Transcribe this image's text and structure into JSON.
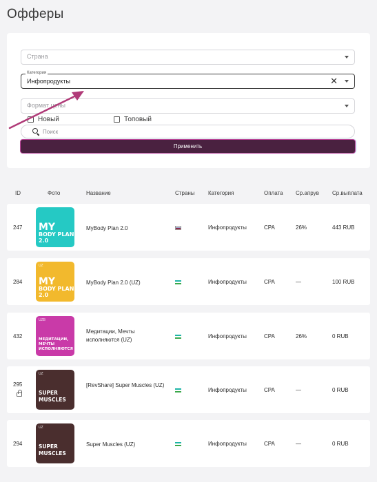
{
  "page": {
    "title": "Офферы"
  },
  "filters": {
    "country": {
      "placeholder": "Страна"
    },
    "category": {
      "label": "Категория",
      "value": "Инфопродукты",
      "clear": "✕"
    },
    "format": {
      "placeholder": "Формат цены"
    },
    "new_label": "Новый",
    "top_label": "Топовый",
    "search": {
      "placeholder": "Поиск"
    },
    "apply_label": "Применить"
  },
  "table": {
    "headers": {
      "id": "ID",
      "photo": "Фото",
      "name": "Название",
      "countries": "Страны",
      "category": "Категория",
      "payment": "Оплата",
      "approval": "Ср.апрув",
      "payout": "Ср.выплата"
    },
    "rows": [
      {
        "id": "247",
        "name": "MyBody Plan 2.0",
        "flag": "ru",
        "category": "Инфопродукты",
        "payment": "CPA",
        "approval": "26%",
        "payout": "443 RUB",
        "thumb_lines": [
          "MY",
          "BODY PLAN",
          "2.0"
        ],
        "thumb_color": "#25c9c4",
        "thumb_small": "",
        "locked": false
      },
      {
        "id": "284",
        "name": "MyBody Plan 2.0 (UZ)",
        "flag": "uz",
        "category": "Инфопродукты",
        "payment": "CPA",
        "approval": "—",
        "payout": "100 RUB",
        "thumb_lines": [
          "MY",
          "BODY PLAN",
          "2.0"
        ],
        "thumb_color": "#f2b92d",
        "thumb_small": "UZ",
        "locked": false
      },
      {
        "id": "432",
        "name": "Медитации, Мечты исполняются (UZ)",
        "flag": "uz",
        "category": "Инфопродукты",
        "payment": "CPA",
        "approval": "26%",
        "payout": "0 RUB",
        "thumb_lines": [
          "МЕДИТАЦИИ,",
          "МЕЧТЫ",
          "ИСПОЛНЯЮТСЯ"
        ],
        "thumb_color": "#c93aa8",
        "thumb_small": "UZB",
        "locked": false
      },
      {
        "id": "295",
        "name": "[RevShare] Super Muscles (UZ)",
        "flag": "uz",
        "category": "Инфопродукты",
        "payment": "CPA",
        "approval": "—",
        "payout": "0 RUB",
        "thumb_lines": [
          "SUPER",
          "MUSCLES"
        ],
        "thumb_color": "#4a2e2e",
        "thumb_small": "UZ",
        "locked": true
      },
      {
        "id": "294",
        "name": "Super Muscles (UZ)",
        "flag": "uz",
        "category": "Инфопродукты",
        "payment": "CPA",
        "approval": "—",
        "payout": "0 RUB",
        "thumb_lines": [
          "SUPER",
          "MUSCLES"
        ],
        "thumb_color": "#4a2e2e",
        "thumb_small": "UZ",
        "locked": false
      }
    ]
  }
}
